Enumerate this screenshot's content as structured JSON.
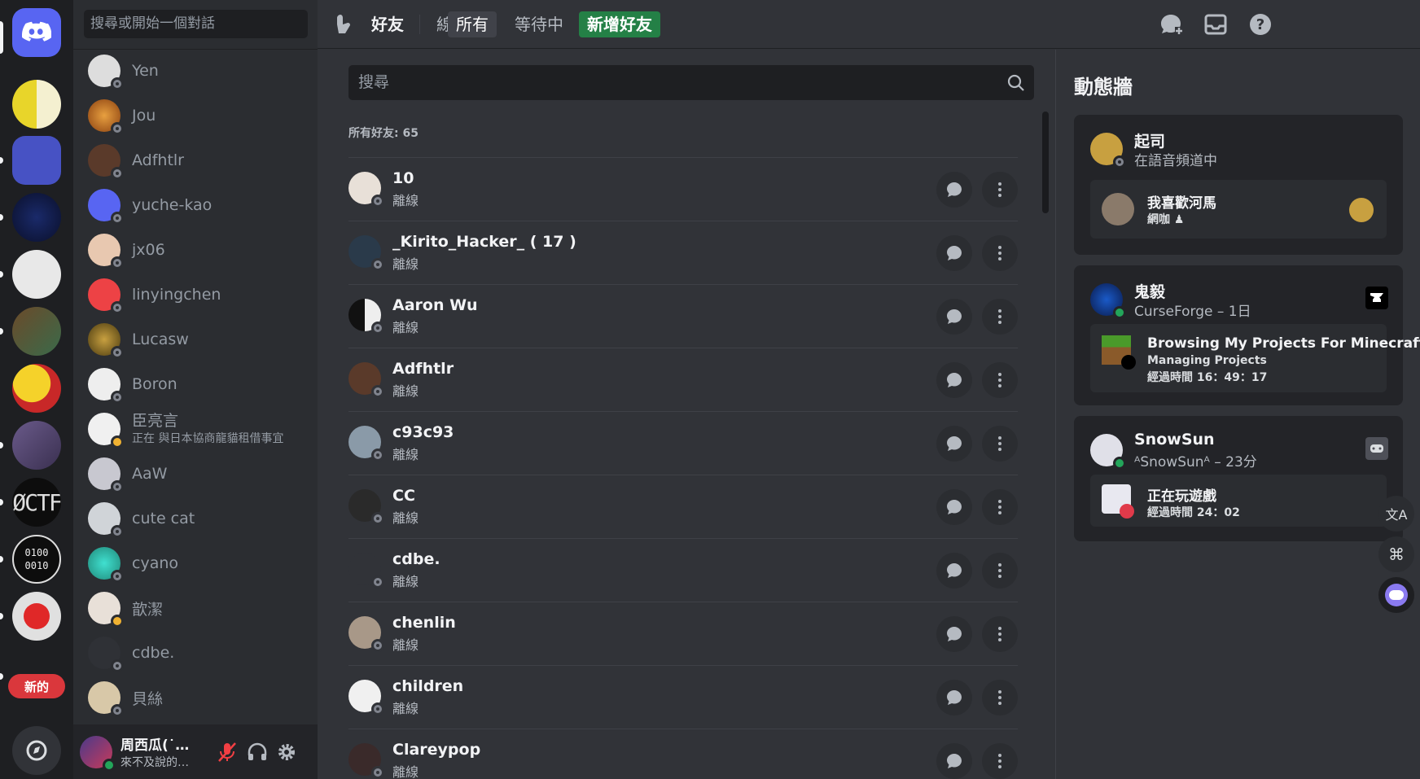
{
  "dm_column": {
    "search_placeholder": "搜尋或開始一個對話",
    "items": [
      {
        "name": "Yen"
      },
      {
        "name": "Jou"
      },
      {
        "name": "Adfhtlr"
      },
      {
        "name": "yuche-kao"
      },
      {
        "name": "jx06"
      },
      {
        "name": "linyingchen"
      },
      {
        "name": "Lucasw"
      },
      {
        "name": "Boron"
      },
      {
        "name": "臣亮言",
        "status": "正在 與日本協商龍貓租借事宜"
      },
      {
        "name": "AaW"
      },
      {
        "name": "cute cat"
      },
      {
        "name": "cyano"
      },
      {
        "name": "歆潔"
      },
      {
        "name": "cdbe."
      },
      {
        "name": "貝絲"
      }
    ],
    "user_panel": {
      "name": "周西瓜(˙…",
      "status": "來不及說的…"
    }
  },
  "server_rail": {
    "new_badge": "新的"
  },
  "topbar": {
    "title": "好友",
    "tabs": [
      "線上",
      "所有",
      "等待中"
    ],
    "active_tab": "所有",
    "add_friend": "新增好友"
  },
  "friends": {
    "search_placeholder": "搜尋",
    "count_label": "所有好友: 65",
    "rows": [
      {
        "name": "10",
        "status": "離線"
      },
      {
        "name": "_Kirito_Hacker_ ( 17 )",
        "status": "離線"
      },
      {
        "name": "Aaron Wu",
        "status": "離線"
      },
      {
        "name": "Adfhtlr",
        "status": "離線"
      },
      {
        "name": "c93c93",
        "status": "離線"
      },
      {
        "name": "CC",
        "status": "離線"
      },
      {
        "name": "cdbe.",
        "status": "離線"
      },
      {
        "name": "chenlin",
        "status": "離線"
      },
      {
        "name": "children",
        "status": "離線"
      },
      {
        "name": "Clareypop",
        "status": "離線"
      }
    ]
  },
  "activity": {
    "title": "動態牆",
    "cards": [
      {
        "name": "起司",
        "sub": "在語音頻道中",
        "inner_title": "我喜歡河馬",
        "inner_sub": "網咖 ♟"
      },
      {
        "name": "鬼毅",
        "sub": "CurseForge – 1日",
        "inner_title": "Browsing My Projects For Minecraft",
        "inner_sub": "Managing Projects",
        "inner_sub2": "經過時間 16：49：17"
      },
      {
        "name": "SnowSun",
        "sub": "ᴬSnowSunᴬ – 23分",
        "inner_title": "正在玩遊戲",
        "inner_sub": "經過時間 24：02"
      }
    ]
  },
  "colors": {
    "brand": "#5865f2",
    "green": "#248046",
    "online": "#23a55a",
    "idle": "#f0b232",
    "danger": "#da373c"
  }
}
